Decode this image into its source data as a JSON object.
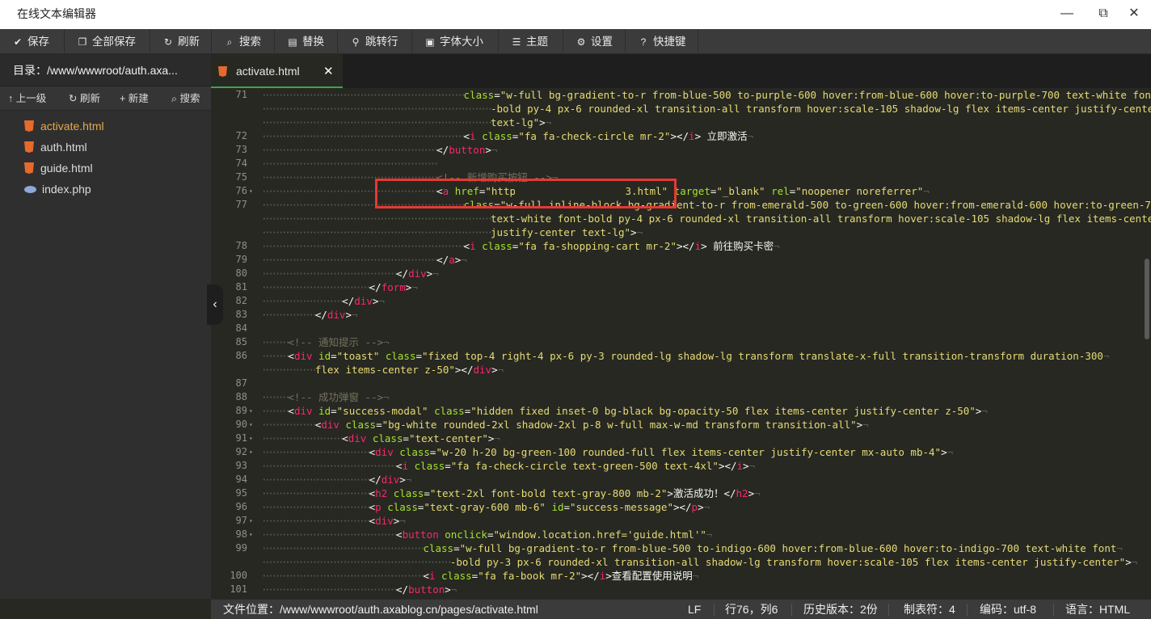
{
  "window": {
    "title": "在线文本编辑器",
    "minimize": "—",
    "maximize": "⧉",
    "close": "✕"
  },
  "toolbar": [
    {
      "icon": "check-icon",
      "glyph": "✔",
      "label": "保存"
    },
    {
      "icon": "copy-icon",
      "glyph": "❐",
      "label": "全部保存"
    },
    {
      "icon": "refresh-icon",
      "glyph": "↻",
      "label": "刷新"
    },
    {
      "icon": "search-icon",
      "glyph": "⌕",
      "label": "搜索"
    },
    {
      "icon": "replace-icon",
      "glyph": "▤",
      "label": "替换"
    },
    {
      "icon": "goto-icon",
      "glyph": "⚲",
      "label": "跳转行"
    },
    {
      "icon": "font-icon",
      "glyph": "▣",
      "label": "字体大小"
    },
    {
      "icon": "theme-icon",
      "glyph": "☰",
      "label": "主题"
    },
    {
      "icon": "gear-icon",
      "glyph": "⚙",
      "label": "设置"
    },
    {
      "icon": "help-icon",
      "glyph": "?",
      "label": "快捷键"
    }
  ],
  "sidebar": {
    "directory": "目录：/www/wwwroot/auth.axa...",
    "actions": [
      {
        "icon": "up-arrow-icon",
        "glyph": "↑",
        "label": "上一级"
      },
      {
        "icon": "refresh-icon",
        "glyph": "↻",
        "label": "刷新"
      },
      {
        "icon": "plus-icon",
        "glyph": "+",
        "label": "新建"
      },
      {
        "icon": "search-icon",
        "glyph": "⌕",
        "label": "搜索"
      }
    ],
    "files": [
      {
        "name": "activate.html",
        "type": "html",
        "active": true
      },
      {
        "name": "auth.html",
        "type": "html",
        "active": false
      },
      {
        "name": "guide.html",
        "type": "html",
        "active": false
      },
      {
        "name": "index.php",
        "type": "php",
        "active": false
      }
    ],
    "collapse_glyph": "‹"
  },
  "tab": {
    "label": "activate.html",
    "close": "✕"
  },
  "code_lines": [
    {
      "n": "71",
      "fold": "",
      "indent": 60,
      "segs": [
        [
          "at",
          "class"
        ],
        [
          "tx",
          "="
        ],
        [
          "st",
          "\"w-full bg-gradient-to-r from-blue-500 to-purple-600 hover:from-blue-600 hover:to-purple-700 text-white font"
        ]
      ]
    },
    {
      "n": "",
      "fold": "",
      "indent": 68,
      "segs": [
        [
          "st",
          "-bold py-4 px-6 rounded-xl transition-all transform hover:scale-105 shadow-lg flex items-center justify-center"
        ]
      ]
    },
    {
      "n": "",
      "fold": "",
      "indent": 68,
      "segs": [
        [
          "st",
          "text-lg\""
        ],
        [
          "tx",
          ">"
        ]
      ]
    },
    {
      "n": "72",
      "fold": "",
      "indent": 60,
      "segs": [
        [
          "tx",
          "<"
        ],
        [
          "tg",
          "i"
        ],
        [
          "tx",
          " "
        ],
        [
          "at",
          "class"
        ],
        [
          "tx",
          "="
        ],
        [
          "st",
          "\"fa fa-check-circle mr-2\""
        ],
        [
          "tx",
          "></"
        ],
        [
          "tg",
          "i"
        ],
        [
          "tx",
          "> 立即激活"
        ]
      ]
    },
    {
      "n": "73",
      "fold": "",
      "indent": 52,
      "segs": [
        [
          "tx",
          "</"
        ],
        [
          "tg",
          "button"
        ],
        [
          "tx",
          ">"
        ]
      ]
    },
    {
      "n": "74",
      "fold": "",
      "indent": 52,
      "segs": []
    },
    {
      "n": "75",
      "fold": "",
      "indent": 52,
      "segs": [
        [
          "cm",
          "<!-- 新增购买按钮 -->"
        ]
      ]
    },
    {
      "n": "76",
      "fold": "▾",
      "indent": 52,
      "segs": [
        [
          "tx",
          "<"
        ],
        [
          "tg",
          "a"
        ],
        [
          "tx",
          " "
        ],
        [
          "at",
          "href"
        ],
        [
          "tx",
          "="
        ],
        [
          "st",
          "\"https://nxxy          3.html\""
        ],
        [
          "tx",
          " "
        ],
        [
          "at",
          "target"
        ],
        [
          "tx",
          "="
        ],
        [
          "st",
          "\"_blank\""
        ],
        [
          "tx",
          " "
        ],
        [
          "at",
          "rel"
        ],
        [
          "tx",
          "="
        ],
        [
          "st",
          "\"noopener noreferrer\""
        ]
      ]
    },
    {
      "n": "77",
      "fold": "",
      "indent": 60,
      "segs": [
        [
          "at",
          "class"
        ],
        [
          "tx",
          "="
        ],
        [
          "st",
          "\"w-full inline-block bg-gradient-to-r from-emerald-500 to-green-600 hover:from-emerald-600 hover:to-green-700"
        ]
      ]
    },
    {
      "n": "",
      "fold": "",
      "indent": 68,
      "segs": [
        [
          "st",
          "text-white font-bold py-4 px-6 rounded-xl transition-all transform hover:scale-105 shadow-lg flex items-center"
        ]
      ]
    },
    {
      "n": "",
      "fold": "",
      "indent": 68,
      "segs": [
        [
          "st",
          "justify-center text-lg\""
        ],
        [
          "tx",
          ">"
        ]
      ]
    },
    {
      "n": "78",
      "fold": "",
      "indent": 60,
      "segs": [
        [
          "tx",
          "<"
        ],
        [
          "tg",
          "i"
        ],
        [
          "tx",
          " "
        ],
        [
          "at",
          "class"
        ],
        [
          "tx",
          "="
        ],
        [
          "st",
          "\"fa fa-shopping-cart mr-2\""
        ],
        [
          "tx",
          "></"
        ],
        [
          "tg",
          "i"
        ],
        [
          "tx",
          "> 前往购买卡密"
        ]
      ]
    },
    {
      "n": "79",
      "fold": "",
      "indent": 52,
      "segs": [
        [
          "tx",
          "</"
        ],
        [
          "tg",
          "a"
        ],
        [
          "tx",
          ">"
        ]
      ]
    },
    {
      "n": "80",
      "fold": "",
      "indent": 40,
      "segs": [
        [
          "tx",
          "</"
        ],
        [
          "tg",
          "div"
        ],
        [
          "tx",
          ">"
        ]
      ]
    },
    {
      "n": "81",
      "fold": "",
      "indent": 32,
      "segs": [
        [
          "tx",
          "</"
        ],
        [
          "tg",
          "form"
        ],
        [
          "tx",
          ">"
        ]
      ]
    },
    {
      "n": "82",
      "fold": "",
      "indent": 24,
      "segs": [
        [
          "tx",
          "</"
        ],
        [
          "tg",
          "div"
        ],
        [
          "tx",
          ">"
        ]
      ]
    },
    {
      "n": "83",
      "fold": "",
      "indent": 16,
      "segs": [
        [
          "tx",
          "</"
        ],
        [
          "tg",
          "div"
        ],
        [
          "tx",
          ">"
        ]
      ]
    },
    {
      "n": "84",
      "fold": "",
      "indent": 0,
      "segs": []
    },
    {
      "n": "85",
      "fold": "",
      "indent": 8,
      "segs": [
        [
          "cm",
          "<!-- 通知提示 -->"
        ]
      ]
    },
    {
      "n": "86",
      "fold": "",
      "indent": 8,
      "segs": [
        [
          "tx",
          "<"
        ],
        [
          "tg",
          "div"
        ],
        [
          "tx",
          " "
        ],
        [
          "at",
          "id"
        ],
        [
          "tx",
          "="
        ],
        [
          "st",
          "\"toast\""
        ],
        [
          "tx",
          " "
        ],
        [
          "at",
          "class"
        ],
        [
          "tx",
          "="
        ],
        [
          "st",
          "\"fixed top-4 right-4 px-6 py-3 rounded-lg shadow-lg transform translate-x-full transition-transform duration-300"
        ]
      ]
    },
    {
      "n": "",
      "fold": "",
      "indent": 16,
      "segs": [
        [
          "st",
          "flex items-center z-50\""
        ],
        [
          "tx",
          "></"
        ],
        [
          "tg",
          "div"
        ],
        [
          "tx",
          ">"
        ]
      ]
    },
    {
      "n": "87",
      "fold": "",
      "indent": 0,
      "segs": []
    },
    {
      "n": "88",
      "fold": "",
      "indent": 8,
      "segs": [
        [
          "cm",
          "<!-- 成功弹窗 -->"
        ]
      ]
    },
    {
      "n": "89",
      "fold": "▾",
      "indent": 8,
      "segs": [
        [
          "tx",
          "<"
        ],
        [
          "tg",
          "div"
        ],
        [
          "tx",
          " "
        ],
        [
          "at",
          "id"
        ],
        [
          "tx",
          "="
        ],
        [
          "st",
          "\"success-modal\""
        ],
        [
          "tx",
          " "
        ],
        [
          "at",
          "class"
        ],
        [
          "tx",
          "="
        ],
        [
          "st",
          "\"hidden fixed inset-0 bg-black bg-opacity-50 flex items-center justify-center z-50\""
        ],
        [
          "tx",
          ">"
        ]
      ]
    },
    {
      "n": "90",
      "fold": "▾",
      "indent": 16,
      "segs": [
        [
          "tx",
          "<"
        ],
        [
          "tg",
          "div"
        ],
        [
          "tx",
          " "
        ],
        [
          "at",
          "class"
        ],
        [
          "tx",
          "="
        ],
        [
          "st",
          "\"bg-white rounded-2xl shadow-2xl p-8 w-full max-w-md transform transition-all\""
        ],
        [
          "tx",
          ">"
        ]
      ]
    },
    {
      "n": "91",
      "fold": "▾",
      "indent": 24,
      "segs": [
        [
          "tx",
          "<"
        ],
        [
          "tg",
          "div"
        ],
        [
          "tx",
          " "
        ],
        [
          "at",
          "class"
        ],
        [
          "tx",
          "="
        ],
        [
          "st",
          "\"text-center\""
        ],
        [
          "tx",
          ">"
        ]
      ]
    },
    {
      "n": "92",
      "fold": "▾",
      "indent": 32,
      "segs": [
        [
          "tx",
          "<"
        ],
        [
          "tg",
          "div"
        ],
        [
          "tx",
          " "
        ],
        [
          "at",
          "class"
        ],
        [
          "tx",
          "="
        ],
        [
          "st",
          "\"w-20 h-20 bg-green-100 rounded-full flex items-center justify-center mx-auto mb-4\""
        ],
        [
          "tx",
          ">"
        ]
      ]
    },
    {
      "n": "93",
      "fold": "",
      "indent": 40,
      "segs": [
        [
          "tx",
          "<"
        ],
        [
          "tg",
          "i"
        ],
        [
          "tx",
          " "
        ],
        [
          "at",
          "class"
        ],
        [
          "tx",
          "="
        ],
        [
          "st",
          "\"fa fa-check-circle text-green-500 text-4xl\""
        ],
        [
          "tx",
          "></"
        ],
        [
          "tg",
          "i"
        ],
        [
          "tx",
          ">"
        ]
      ]
    },
    {
      "n": "94",
      "fold": "",
      "indent": 32,
      "segs": [
        [
          "tx",
          "</"
        ],
        [
          "tg",
          "div"
        ],
        [
          "tx",
          ">"
        ]
      ]
    },
    {
      "n": "95",
      "fold": "",
      "indent": 32,
      "segs": [
        [
          "tx",
          "<"
        ],
        [
          "tg",
          "h2"
        ],
        [
          "tx",
          " "
        ],
        [
          "at",
          "class"
        ],
        [
          "tx",
          "="
        ],
        [
          "st",
          "\"text-2xl font-bold text-gray-800 mb-2\""
        ],
        [
          "tx",
          ">激活成功！</"
        ],
        [
          "tg",
          "h2"
        ],
        [
          "tx",
          ">"
        ]
      ]
    },
    {
      "n": "96",
      "fold": "",
      "indent": 32,
      "segs": [
        [
          "tx",
          "<"
        ],
        [
          "tg",
          "p"
        ],
        [
          "tx",
          " "
        ],
        [
          "at",
          "class"
        ],
        [
          "tx",
          "="
        ],
        [
          "st",
          "\"text-gray-600 mb-6\""
        ],
        [
          "tx",
          " "
        ],
        [
          "at",
          "id"
        ],
        [
          "tx",
          "="
        ],
        [
          "st",
          "\"success-message\""
        ],
        [
          "tx",
          "></"
        ],
        [
          "tg",
          "p"
        ],
        [
          "tx",
          ">"
        ]
      ]
    },
    {
      "n": "97",
      "fold": "▾",
      "indent": 32,
      "segs": [
        [
          "tx",
          "<"
        ],
        [
          "tg",
          "div"
        ],
        [
          "tx",
          ">"
        ]
      ]
    },
    {
      "n": "98",
      "fold": "▾",
      "indent": 40,
      "segs": [
        [
          "tx",
          "<"
        ],
        [
          "tg",
          "button"
        ],
        [
          "tx",
          " "
        ],
        [
          "at",
          "onclick"
        ],
        [
          "tx",
          "="
        ],
        [
          "st",
          "\"window.location.href='guide.html'\""
        ]
      ]
    },
    {
      "n": "99",
      "fold": "",
      "indent": 48,
      "segs": [
        [
          "at",
          "class"
        ],
        [
          "tx",
          "="
        ],
        [
          "st",
          "\"w-full bg-gradient-to-r from-blue-500 to-indigo-600 hover:from-blue-600 hover:to-indigo-700 text-white font"
        ]
      ]
    },
    {
      "n": "",
      "fold": "",
      "indent": 56,
      "segs": [
        [
          "st",
          "-bold py-3 px-6 rounded-xl transition-all shadow-lg transform hover:scale-105 flex items-center justify-center\""
        ],
        [
          "tx",
          ">"
        ]
      ]
    },
    {
      "n": "100",
      "fold": "",
      "indent": 48,
      "segs": [
        [
          "tx",
          "<"
        ],
        [
          "tg",
          "i"
        ],
        [
          "tx",
          " "
        ],
        [
          "at",
          "class"
        ],
        [
          "tx",
          "="
        ],
        [
          "st",
          "\"fa fa-book mr-2\""
        ],
        [
          "tx",
          "></"
        ],
        [
          "tg",
          "i"
        ],
        [
          "tx",
          ">查看配置使用说明"
        ]
      ]
    },
    {
      "n": "101",
      "fold": "",
      "indent": 40,
      "segs": [
        [
          "tx",
          "</"
        ],
        [
          "tg",
          "button"
        ],
        [
          "tx",
          ">"
        ]
      ]
    }
  ],
  "status": {
    "path": "文件位置：/www/wwwroot/auth.axablog.cn/pages/activate.html",
    "eol": "LF",
    "cursor": "行76，列6",
    "history": "历史版本：2份",
    "tab": "制表符：4",
    "encoding": "编码：utf-8",
    "language": "语言：HTML"
  }
}
